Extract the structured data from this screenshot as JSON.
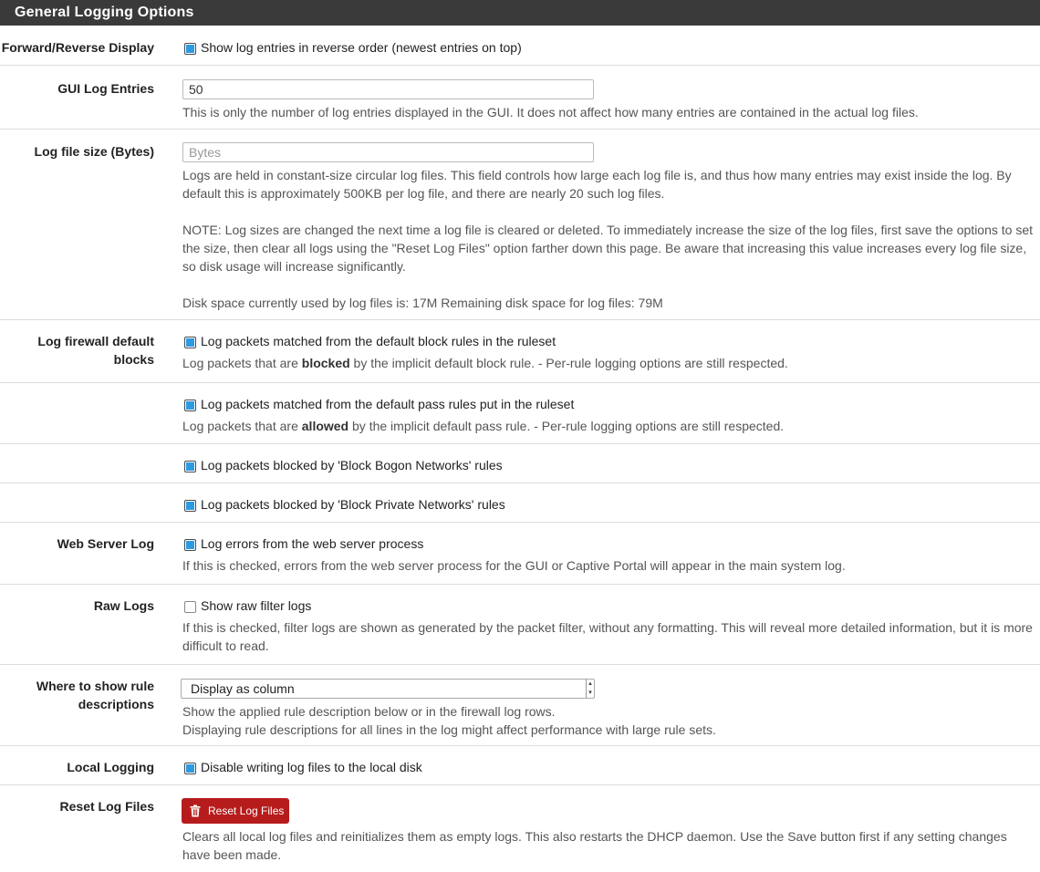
{
  "panel": {
    "title": "General Logging Options"
  },
  "rows": {
    "forward_reverse": {
      "label": "Forward/Reverse Display",
      "checkbox_label": "Show log entries in reverse order (newest entries on top)",
      "checked": true
    },
    "gui_log_entries": {
      "label": "GUI Log Entries",
      "value": "50",
      "help": "This is only the number of log entries displayed in the GUI. It does not affect how many entries are contained in the actual log files."
    },
    "log_file_size": {
      "label": "Log file size (Bytes)",
      "placeholder": "Bytes",
      "help1": "Logs are held in constant-size circular log files. This field controls how large each log file is, and thus how many entries may exist inside the log. By default this is approximately 500KB per log file, and there are nearly 20 such log files.",
      "help2": "NOTE: Log sizes are changed the next time a log file is cleared or deleted. To immediately increase the size of the log files, first save the options to set the size, then clear all logs using the \"Reset Log Files\" option farther down this page. Be aware that increasing this value increases every log file size, so disk usage will increase significantly.",
      "help3": "Disk space currently used by log files is: 17M Remaining disk space for log files: 79M"
    },
    "log_default_blocks": {
      "label": "Log firewall default blocks",
      "checkbox_label": "Log packets matched from the default block rules in the ruleset",
      "checked": true,
      "help_pre": "Log packets that are ",
      "help_bold": "blocked",
      "help_post": " by the implicit default block rule. - Per-rule logging options are still respected."
    },
    "log_default_pass": {
      "checkbox_label": "Log packets matched from the default pass rules put in the ruleset",
      "checked": true,
      "help_pre": "Log packets that are ",
      "help_bold": "allowed",
      "help_post": " by the implicit default pass rule. - Per-rule logging options are still respected."
    },
    "log_bogon": {
      "checkbox_label": "Log packets blocked by 'Block Bogon Networks' rules",
      "checked": true
    },
    "log_private": {
      "checkbox_label": "Log packets blocked by 'Block Private Networks' rules",
      "checked": true
    },
    "web_server_log": {
      "label": "Web Server Log",
      "checkbox_label": "Log errors from the web server process",
      "checked": true,
      "help": "If this is checked, errors from the web server process for the GUI or Captive Portal will appear in the main system log."
    },
    "raw_logs": {
      "label": "Raw Logs",
      "checkbox_label": "Show raw filter logs",
      "checked": false,
      "help": "If this is checked, filter logs are shown as generated by the packet filter, without any formatting. This will reveal more detailed information, but it is more difficult to read."
    },
    "rule_descriptions": {
      "label": "Where to show rule descriptions",
      "selected": "Display as column",
      "help1": "Show the applied rule description below or in the firewall log rows.",
      "help2": "Displaying rule descriptions for all lines in the log might affect performance with large rule sets."
    },
    "local_logging": {
      "label": "Local Logging",
      "checkbox_label": "Disable writing log files to the local disk",
      "checked": true
    },
    "reset_log_files": {
      "label": "Reset Log Files",
      "button_label": "Reset Log Files",
      "button_icon": "trash-icon",
      "help": "Clears all local log files and reinitializes them as empty logs. This also restarts the DHCP daemon. Use the Save button first if any setting changes have been made."
    }
  },
  "colors": {
    "heading_bg": "#3a3a3a",
    "checkbox_on": "#2e9ae0",
    "danger": "#b71c1c"
  }
}
